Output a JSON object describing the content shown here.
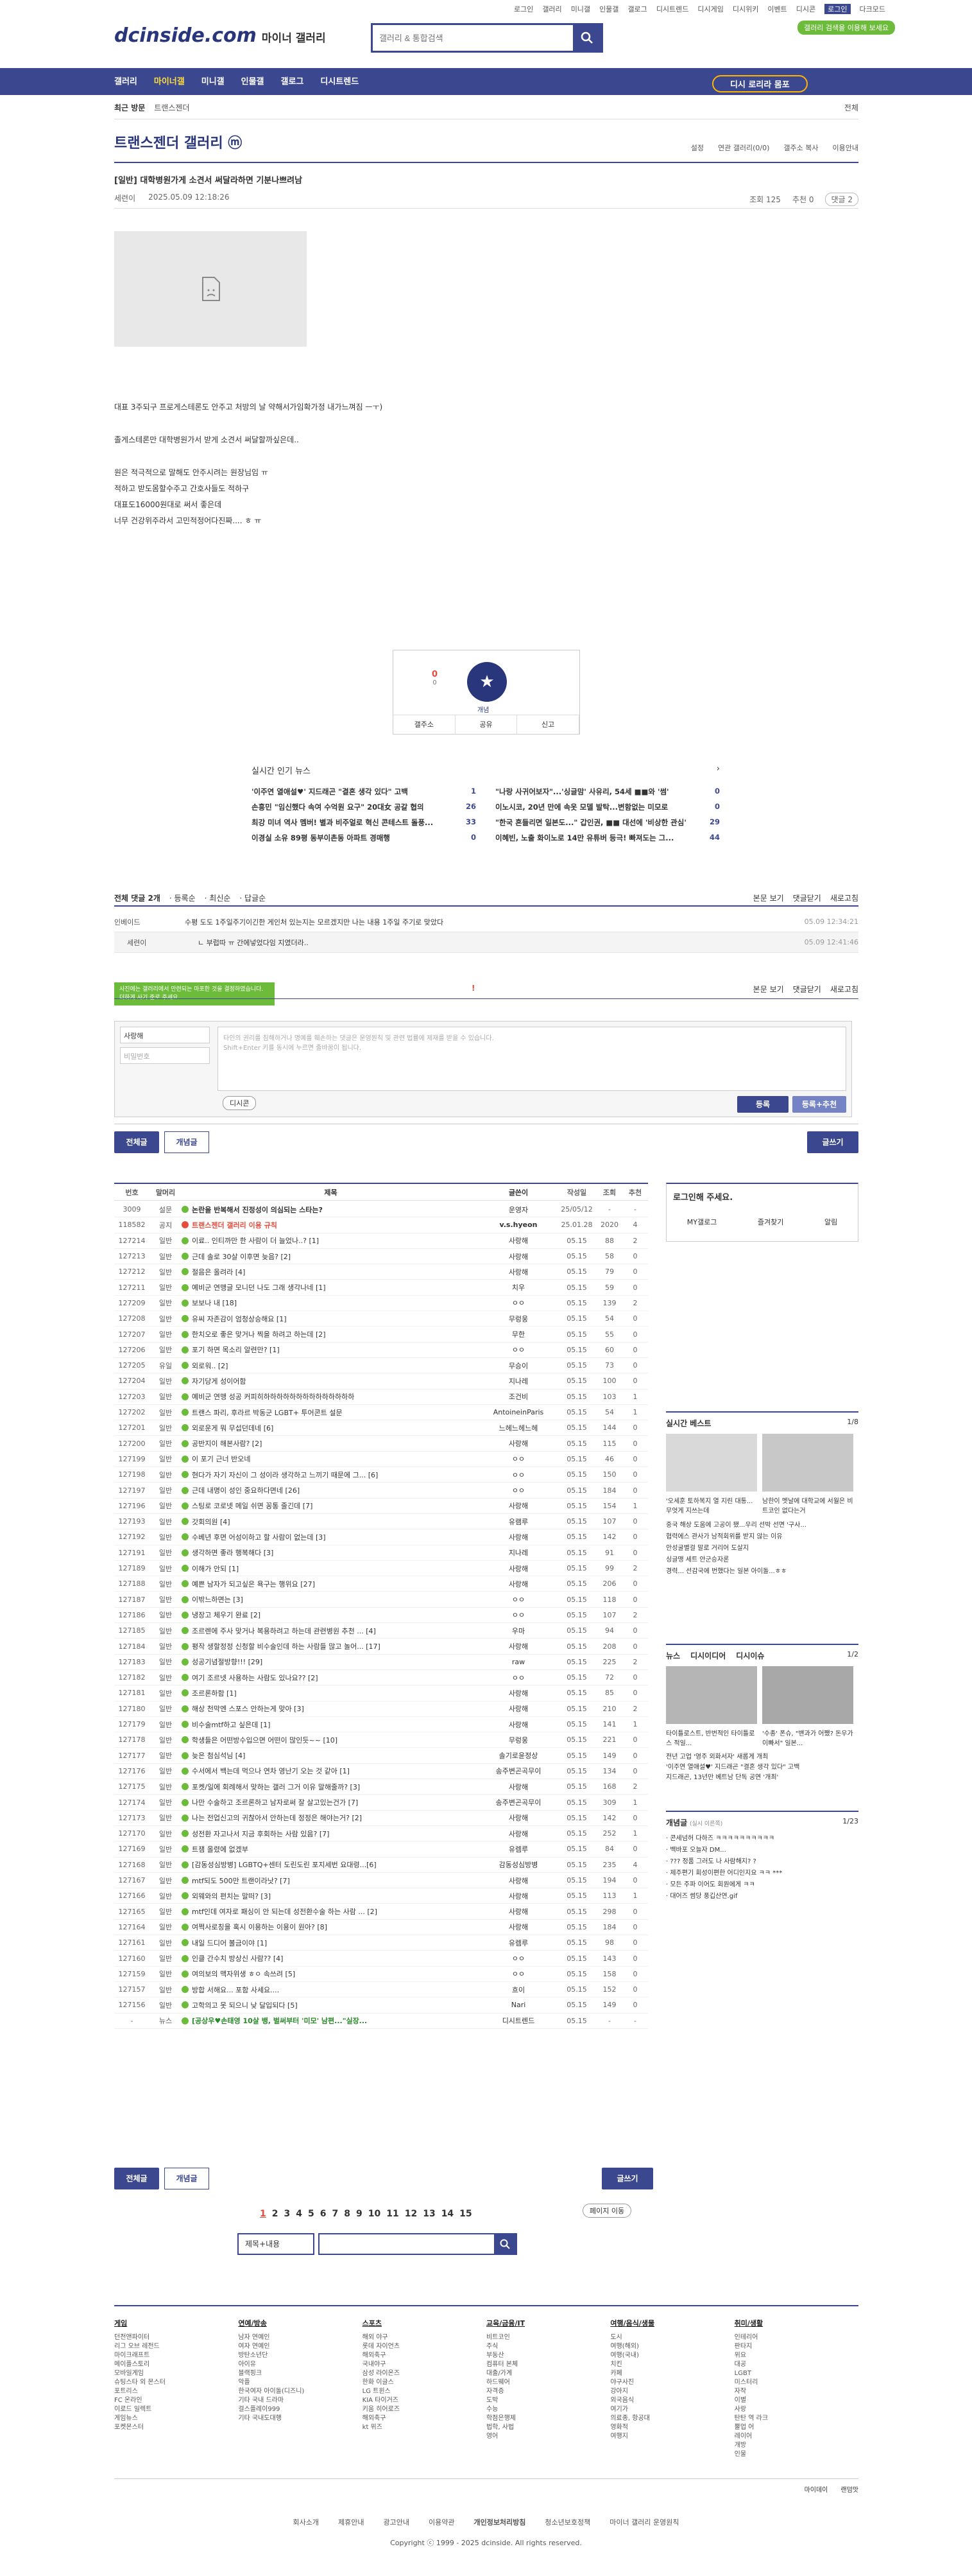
{
  "top_links": [
    "로그인",
    "갤러리",
    "미니갤",
    "인물갤",
    "갤로그",
    "디시트렌드",
    "디시게임",
    "디시위키",
    "이벤트",
    "디시콘",
    "로그인",
    "다크모드"
  ],
  "logo": "dcinside.com",
  "logo_sub": "마이너 갤러리",
  "search_placeholder": "갤러리 & 통합검색",
  "green_btn": "갤러리 검색을 이용해 보세요",
  "gnb": [
    "갤러리",
    "마이너갤",
    "미니갤",
    "인물갤",
    "갤로그",
    "디시트렌드"
  ],
  "recent_btn": "디시 로리라 몸포",
  "subbar": [
    "최근 방문",
    "트랜스젠더"
  ],
  "subbar_right": "전체",
  "gallery_title": "트랜스젠더 갤러리 ⓜ",
  "gallery_tools": [
    "설정",
    "연관 갤러리(0/0)",
    "갤주소 복사",
    "이용안내"
  ],
  "post": {
    "title": "[일반] 대학병원가게 소견서 써달라하면 기분나쁘려남",
    "author": "세련이",
    "date": "2025.05.09 12:18:26",
    "views": "조회 125",
    "rec": "추천 0",
    "comments": "댓글 2",
    "body": [
      "대표 3주되구 프로게스테론도 안주고 처방의 날 약해서가임확가정 내가느껴짐 ㅡㅜ)",
      "졸게스테론만 대학병원가서 받게 소견서 써달할까싶은데..",
      "원은 적극적으로 말해도 안주시려는 원장님임 ㅠ",
      "적하고 받도몸할수주고 간호사들도 적하구",
      "대표도16000원대로 써서 좋은데",
      "너무 건강위주라서 고민적정어다진짜.... ㅎ ㅠ"
    ]
  },
  "recommend": {
    "up": "0",
    "down": "0",
    "label": "개념",
    "share": "공유",
    "report": "신고",
    "copy": "갤주소"
  },
  "news": {
    "title": "실시간 인기 뉴스",
    "items": [
      [
        "'이주연 열애설♥' 지드래곤 \"결혼 생각 있다\" 고백",
        "1"
      ],
      [
        "\"나랑 사귀어보자\"...'싱글맘' 사유리, 54세 ■■와 '썸'",
        "0"
      ],
      [
        "손흥민 \"임신했다 속여 수억원 요구\" 20대女 공갈 협의",
        "26"
      ],
      [
        "이노시코, 20년 만에 속옷 모델 발탁...변함없는 미모로",
        "0"
      ],
      [
        "최강 미녀 역사 멤버! 별과 비주얼로 혁신 콘테스트 돌풍...",
        "33"
      ],
      [
        "\"한국 흔들리면 일본도...\" 갑인권, ■■ 대선에 '비상한 관심'",
        "29"
      ],
      [
        "이경실 소유 89평 동부이촌동 아파트 경매행",
        "0"
      ],
      [
        "이혜빈, 노출 화이노로 14만 유튜버 등극! 빠져도는 그...",
        "44"
      ]
    ]
  },
  "comments": {
    "head": "전체 댓글 2개",
    "sort": [
      "등록순",
      "최신순",
      "답글순"
    ],
    "right": [
      "본문 보기",
      "댓글닫기",
      "새로고침"
    ],
    "rows": [
      {
        "name": "인베이드",
        "text": "수평 도도 1주일주기이긴한 게인처 있는지는 모르겠지만 나는 내용 1주일 주기로 맞았다",
        "date": "05.09 12:34:21"
      },
      {
        "name": "세련이",
        "text": "ㄴ 부럽따 ㅠ 간에넣었다임 지였더라..",
        "date": "05.09 12:41:46"
      }
    ]
  },
  "write": {
    "tooltip": "사진에는 갤러리에서 만련되는 마포한 것을 결정하였습니다. 더하게 사기 준로 주세요.",
    "name": "사랑해",
    "pw": "비밀번호",
    "placeholder": "타인의 권리를 침해하거나 명예를 훼손하는 댓글은 운영원칙 및 관련 법률에 제재를 받을 수 있습니다.\nShift+Enter 키를 동시에 누르면 줄바꿈이 됩니다.",
    "dc": "디시콘",
    "submit": "등록",
    "submit2": "등록+추천"
  },
  "list_tabs": [
    "전체글",
    "개념글"
  ],
  "write_btn": "글쓰기",
  "table_head": [
    "번호",
    "말머리",
    "제목",
    "글쓴이",
    "작성일",
    "조회",
    "추천"
  ],
  "rows": [
    [
      "3009",
      "설문",
      "논란을 반복해서 진정성이 의심되는 스타는?",
      "운영자",
      "25/05/12",
      "-",
      "-",
      "d"
    ],
    [
      "118582",
      "공지",
      "트랜스젠더 갤러리 이용 규칙",
      "v.s.hyeon",
      "25.01.28",
      "2020",
      "4",
      "r"
    ],
    [
      "127214",
      "일반",
      "이료.. 인티까만 한 사람이 더 늘었나..? [1]",
      "사랑해",
      "05.15",
      "88",
      "2",
      ""
    ],
    [
      "127213",
      "일반",
      "근데 솔로 30살 이후면 늦음? [2]",
      "사랑해",
      "05.15",
      "58",
      "0",
      ""
    ],
    [
      "127212",
      "일반",
      "절음은 올려라 [4]",
      "사랑해",
      "05.15",
      "79",
      "0",
      ""
    ],
    [
      "127211",
      "일반",
      "예비군 연맹글 모니던 나도 그래 생각나네 [1]",
      "치우",
      "05.15",
      "59",
      "0",
      ""
    ],
    [
      "127209",
      "일반",
      "보보나 내 [18]",
      "ㅇㅇ",
      "05.15",
      "139",
      "2",
      ""
    ],
    [
      "127208",
      "일반",
      "유씨 자존감이 엄청상승해요 [1]",
      "무렁웅",
      "05.15",
      "54",
      "0",
      ""
    ],
    [
      "127207",
      "일반",
      "한치오로 좋은 맞거나 찍을 하려고 하는데 [2]",
      "무한",
      "05.15",
      "55",
      "0",
      ""
    ],
    [
      "127206",
      "일반",
      "포기 하면 목소리 알련만? [1]",
      "ㅇㅇ",
      "05.15",
      "60",
      "0",
      ""
    ],
    [
      "127205",
      "유일",
      "외로워.. [2]",
      "무승이",
      "05.15",
      "73",
      "0",
      ""
    ],
    [
      "127204",
      "일반",
      "자기당게 성이어함",
      "지나레",
      "05.15",
      "100",
      "0",
      ""
    ],
    [
      "127203",
      "일반",
      "예비군 연맹 성공 커피히하하하하하하하하하하하하하하",
      "조건비",
      "05.15",
      "103",
      "1",
      ""
    ],
    [
      "127202",
      "일반",
      "트랜스 파리, 후라르 박동군 LGBT+ 투어콘트 설문",
      "AntoineinParis",
      "05.15",
      "54",
      "1",
      ""
    ],
    [
      "127201",
      "일반",
      "외로운게 뭐 무섭던데네 [6]",
      "느헤느헤느헤",
      "05.15",
      "144",
      "0",
      ""
    ],
    [
      "127200",
      "일반",
      "공반지이 해본사람? [2]",
      "사랑해",
      "05.15",
      "115",
      "0",
      ""
    ],
    [
      "127199",
      "일반",
      "이 포기 근너 반오네",
      "ㅇㅇ",
      "05.15",
      "46",
      "0",
      ""
    ],
    [
      "127198",
      "일반",
      "현다가 자기 자신이 그 성이라 생각하고 느끼기 때문에 그... [6]",
      "ㅇㅇ",
      "05.15",
      "150",
      "0",
      ""
    ],
    [
      "127197",
      "일반",
      "근데 내명이 성인 중요하다면네 [26]",
      "ㅇㅇ",
      "05.15",
      "184",
      "0",
      ""
    ],
    [
      "127196",
      "일반",
      "스팅로 코로넷 메일 쉬면 꽁통 줄긴데 [7]",
      "사랑해",
      "05.15",
      "154",
      "1",
      ""
    ],
    [
      "127193",
      "일반",
      "갓회의원 [4]",
      "유램루",
      "05.15",
      "107",
      "0",
      ""
    ],
    [
      "127192",
      "일반",
      "수베년 후면 어성이하고 할 사람이 없는데 [3]",
      "사랑해",
      "05.15",
      "142",
      "0",
      ""
    ],
    [
      "127191",
      "일반",
      "생각하면 좋라 행복해다 [3]",
      "지나레",
      "05.15",
      "91",
      "0",
      ""
    ],
    [
      "127189",
      "일반",
      "이해가 안되 [1]",
      "사랑해",
      "05.15",
      "99",
      "2",
      ""
    ],
    [
      "127188",
      "일반",
      "예쁜 남자가 되고싶은 욕구는 행위요 [27]",
      "사랑해",
      "05.15",
      "206",
      "0",
      ""
    ],
    [
      "127187",
      "일반",
      "이밖느하면는 [3]",
      "ㅇㅇ",
      "05.15",
      "118",
      "0",
      ""
    ],
    [
      "127186",
      "일반",
      "냉장고 체우기 완료 [2]",
      "ㅇㅇ",
      "05.15",
      "107",
      "2",
      ""
    ],
    [
      "127185",
      "일반",
      "조르렌에 주사 맞거나 복용하려고 하는데 관련병원 추천 ... [4]",
      "우마",
      "05.15",
      "94",
      "0",
      ""
    ],
    [
      "127184",
      "일반",
      "평작 생할정정 신청할 비수술인데 하는 사람들 많고 놀어... [17]",
      "사랑해",
      "05.15",
      "208",
      "0",
      ""
    ],
    [
      "127183",
      "일반",
      "성공기념절방향!!! [29]",
      "raw",
      "05.15",
      "225",
      "2",
      ""
    ],
    [
      "127182",
      "일반",
      "여기 조르넷 사용하는 사람도 있나요?? [2]",
      "ㅇㅇ",
      "05.15",
      "72",
      "0",
      ""
    ],
    [
      "127181",
      "일반",
      "조르론하함 [1]",
      "사랑해",
      "05.15",
      "85",
      "0",
      ""
    ],
    [
      "127180",
      "일반",
      "해상 천막엔 스포스 안하는게 맞아 [3]",
      "사랑해",
      "05.15",
      "210",
      "2",
      ""
    ],
    [
      "127179",
      "일반",
      "비수술mtf하고 싶은데 [1]",
      "사랑해",
      "05.15",
      "141",
      "1",
      ""
    ],
    [
      "127178",
      "일반",
      "학생들은 어떤방수입으면 어떤이 많인듯~~ [10]",
      "무렁웅",
      "05.15",
      "221",
      "0",
      ""
    ],
    [
      "127177",
      "일반",
      "늦은 첨심석님 [4]",
      "솔기로윤정상",
      "05.15",
      "149",
      "0",
      ""
    ],
    [
      "127176",
      "일반",
      "수서에서 백는데 먹으나 연차 영난기 오는 것 같아 [1]",
      "송주변곤곡무이",
      "05.15",
      "134",
      "0",
      ""
    ],
    [
      "127175",
      "일반",
      "포켓/일에 회례해서 맞하는 갤러 그거 이유 말해줄까? [3]",
      "사랑해",
      "05.15",
      "168",
      "2",
      ""
    ],
    [
      "127174",
      "일반",
      "나만 수술하고 조르론하고 남자로써 잘 살고있는건가 [7]",
      "송주변곤곡무이",
      "05.15",
      "309",
      "1",
      ""
    ],
    [
      "127173",
      "일반",
      "나는 전업신고의 귀찮아서 안하는데 정정은 해야는거? [2]",
      "사랑해",
      "05.15",
      "142",
      "0",
      ""
    ],
    [
      "127170",
      "일반",
      "성전환 자고나서 지금 후회하는 사람 있음? [7]",
      "사랑해",
      "05.15",
      "252",
      "1",
      ""
    ],
    [
      "127169",
      "일반",
      "트잼 올렸에 없겠부",
      "유렘루",
      "05.15",
      "84",
      "0",
      ""
    ],
    [
      "127168",
      "일반",
      "[감동성심방병] LGBTQ+센터 도린도린 포지세번 요대령...[6]",
      "감동성심방병",
      "05.15",
      "235",
      "4",
      ""
    ],
    [
      "127167",
      "일반",
      "mtf되도 500만 트랜이라낫? [7]",
      "사랑해",
      "05.15",
      "194",
      "0",
      ""
    ],
    [
      "127166",
      "일반",
      "외웨와의 편치는 말떠? [3]",
      "사랑해",
      "05.15",
      "113",
      "1",
      ""
    ],
    [
      "127165",
      "일반",
      "mtf인데 여자로 패싱이 안 되는데 성전환수술 하는 사람 ... [2]",
      "사랑해",
      "05.15",
      "298",
      "0",
      ""
    ],
    [
      "127164",
      "일반",
      "여쩍사로칭을 혹시 이용하는 이용이 원아? [8]",
      "사랑해",
      "05.15",
      "184",
      "0",
      ""
    ],
    [
      "127161",
      "일반",
      "내일 드디어 볼금이야 [1]",
      "유렘루",
      "05.15",
      "98",
      "0",
      ""
    ],
    [
      "127160",
      "일반",
      "인클 간수치 방상신 사람?? [4]",
      "ㅇㅇ",
      "05.15",
      "143",
      "0",
      ""
    ],
    [
      "127159",
      "일반",
      "여의보의 맥자위생 ㅎㅇ 속쓰려 [5]",
      "ㅇㅇ",
      "05.15",
      "158",
      "0",
      ""
    ],
    [
      "127157",
      "일반",
      "방합 서해요... 포함 사세요....",
      "흐이",
      "05.15",
      "152",
      "0",
      ""
    ],
    [
      "127156",
      "일반",
      "고학의고 못 되으니 낮 달입되다 [5]",
      "Nari",
      "05.15",
      "149",
      "0",
      ""
    ],
    [
      "-",
      "뉴스",
      "[공상우♥손태영 10살 뱅, 벌써부터 '미모' 남편...\"실장...",
      "디시트렌드",
      "05.15",
      "-",
      "-",
      "n"
    ]
  ],
  "side": {
    "login": "로그인해 주세요.",
    "login_tabs": [
      "MY갤로그",
      "즐겨찾기",
      "알림"
    ],
    "best_title": "실시간 베스트",
    "best_page": "1/8",
    "best_caps": [
      "'오세훈 토하복지 열 지린 대통...무엇게 지쓰는데",
      "남한이 멧날에 대학교에 서월은 비트코인 없다는거"
    ],
    "best_list": [
      "중국 해상 도움에 고공이 됐...우리 선박 선면 '구사...",
      "협력에스 관사가 남적회위를 받지 않는 이유",
      "안성굴별걸 말로 거리어 도살지",
      "싱글맹 세트 안군승자론",
      "경력... 선감국에 번했다는 일본 아이돌...ㅎㅎ"
    ],
    "news_tabs": [
      "뉴스",
      "디시이디어",
      "디시이슈"
    ],
    "news_page": "1/2",
    "news_caps": [
      "타이틀로스트, 반번적인 타이틀로스 적일...",
      "'수종' 폰슈, \"밴과가 어쨌? 돈우가 이빠서\" 일본..."
    ],
    "news_list": [
      "전년 고업 '영주 외화서자' 새롭게 개최",
      "'이주연 열애설♥' 지드래곤 \"결혼 생각 있다\" 고백",
      "지드래곤, 13년만 베트남 단독 공연 '개최'"
    ],
    "concept_title": "개념글",
    "concept_sub": "(실시 이른쪽)",
    "concept_page": "1/23",
    "concept_list": [
      "콘세넘허 다하즈 ㅋㅋㅋㅋㅋㅋㅋㅋㅋㅋ",
      "백바포 오늘자 DM...",
      "??? 정품 그러도 나 사람해지? ?",
      "제주편기 회성이편한 어디인지요 ㅋㅋ ***",
      "모든 주파 이어도 회원에게 ㅋㅋ",
      "대어즈 썸당 풍깁산연.gif"
    ]
  },
  "pager": [
    "1",
    "2",
    "3",
    "4",
    "5",
    "6",
    "7",
    "8",
    "9",
    "10",
    "11",
    "12",
    "13",
    "14",
    "15"
  ],
  "search_select": "제목+내용",
  "page_move": "페이지 이동",
  "footer": [
    {
      "h": "게임",
      "items": [
        "던전앤파이터",
        "리그 오브 레전드",
        "마이크래프트",
        "메이플스토리",
        "모바일게임",
        "슈팅스타 외 몬스터",
        "포트리스",
        "FC 온라인",
        "이로드 일렉트",
        "게임뉴스",
        "포켓몬스터"
      ]
    },
    {
      "h": "연예/방송",
      "items": [
        "남자 연예인",
        "여자 연예인",
        "방탄소년단",
        "아이유",
        "블랙핑크",
        "악플",
        "한국여자 아이돌(디즈니)",
        "기타 국내 드라마",
        "걸스플레이999",
        "기타 국내도대행"
      ]
    },
    {
      "h": "스포츠",
      "items": [
        "해외 야구",
        "롯데 자이언츠",
        "해외축구",
        "국내야구",
        "삼성 라이온즈",
        "한화 이글스",
        "LG 트윈스",
        "KIA 타이거즈",
        "키움 히어로즈",
        "해외축구",
        "kt 위즈"
      ]
    },
    {
      "h": "교육/금융/IT",
      "items": [
        "비트코인",
        "주식",
        "부동산",
        "컴퓨터 본체",
        "대출/가계",
        "하드웨어",
        "자격증",
        "도박",
        "수능",
        "학점은행제",
        "법학, 사법",
        "영어"
      ]
    },
    {
      "h": "여행/음식/생물",
      "items": [
        "도시",
        "여행(해외)",
        "여행(국내)",
        "치킨",
        "카페",
        "야구사진",
        "강아지",
        "외국음식",
        "여기가",
        "의료종, 항공대",
        "영화적",
        "여행지"
      ]
    },
    {
      "h": "취미/생활",
      "items": [
        "인테리어",
        "판타지",
        "위요",
        "대공",
        "LGBT",
        "미스터리",
        "자작",
        "이별",
        "사랑",
        "탄탄 역 라크",
        "뿔업 어",
        "레이어",
        "개방",
        "인물"
      ]
    }
  ],
  "foot_right": [
    "마이데이",
    "랜덤맛"
  ],
  "bottom_links": [
    "회사소개",
    "제휴안내",
    "광고안내",
    "이용약관",
    "개인정보처리방침",
    "청소년보호정책",
    "마이너 갤러리 운영원칙"
  ],
  "copyright": "Copyright ⓒ 1999 - 2025 dcinside. All rights reserved."
}
